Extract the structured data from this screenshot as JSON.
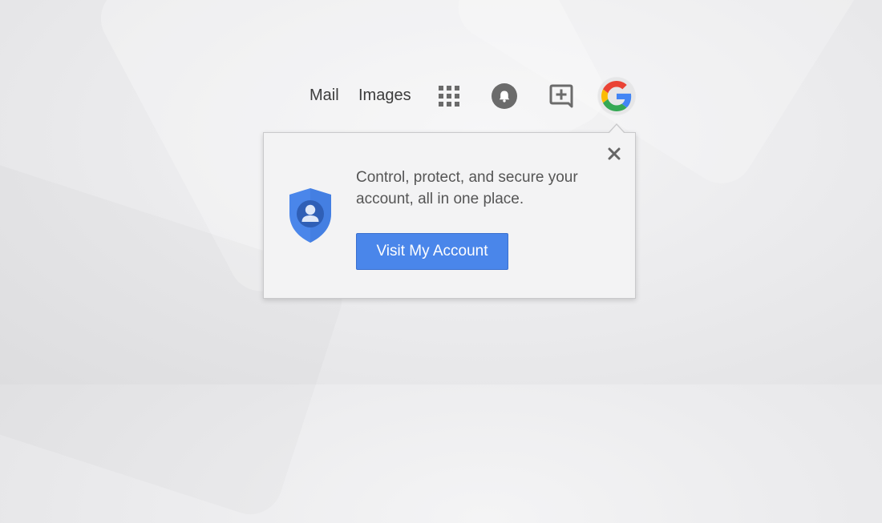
{
  "topnav": {
    "mail_label": "Mail",
    "images_label": "Images",
    "icons": [
      "apps-grid-icon",
      "notifications-bell-icon",
      "share-plus-icon",
      "google-g-logo-icon"
    ]
  },
  "popup": {
    "message": "Control, protect, and secure your account, all in one place.",
    "button_label": "Visit My Account",
    "close_glyph": "×",
    "icon": "account-shield-icon"
  },
  "colors": {
    "button_blue": "#4a86ea",
    "shield_blue": "#4a86ea",
    "google_blue": "#4285f4",
    "google_red": "#ea4335",
    "google_yellow": "#fbbc05",
    "google_green": "#34a853"
  }
}
